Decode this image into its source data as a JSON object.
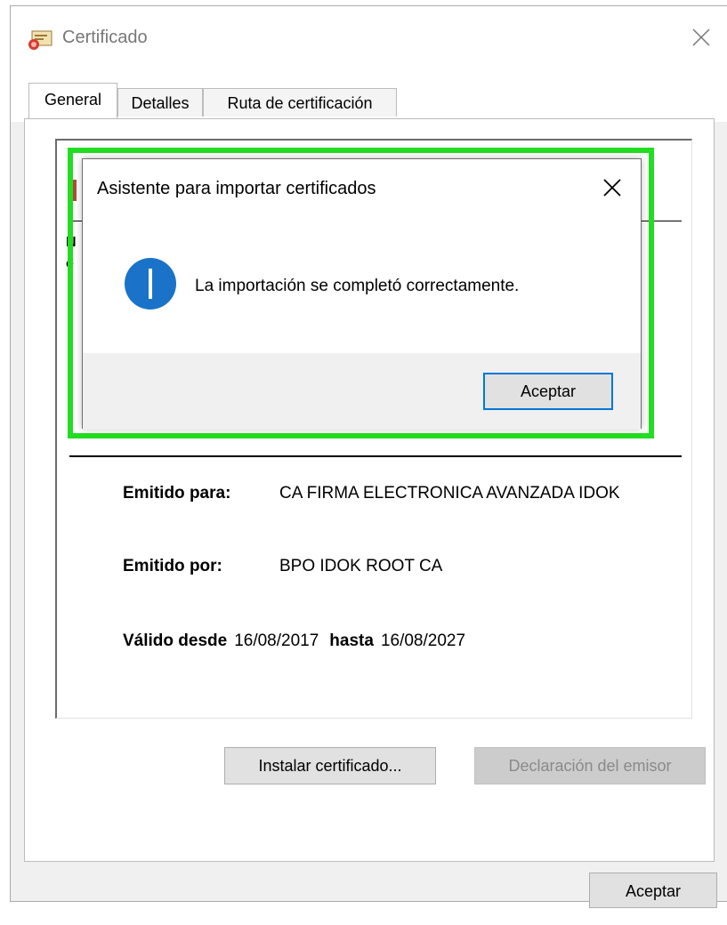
{
  "window": {
    "title": "Certificado"
  },
  "tabs": [
    {
      "label": "General",
      "active": true
    },
    {
      "label": "Detalles",
      "active": false
    },
    {
      "label": "Ruta de certificación",
      "active": false
    }
  ],
  "certificate": {
    "peek_letters": [
      "N",
      "e"
    ],
    "issued_to_label": "Emitido para:",
    "issued_to_value": "CA FIRMA ELECTRONICA AVANZADA IDOK",
    "issued_by_label": "Emitido por:",
    "issued_by_value": "BPO IDOK ROOT CA",
    "valid_from_label": "Válido desde",
    "valid_from_value": "16/08/2017",
    "valid_to_label": "hasta",
    "valid_to_value": "16/08/2027"
  },
  "buttons": {
    "install": "Instalar certificado...",
    "issuer_statement": "Declaración del emisor",
    "ok": "Aceptar"
  },
  "dialog": {
    "title": "Asistente para importar certificados",
    "message": "La importación se completó correctamente.",
    "ok": "Aceptar"
  },
  "colors": {
    "highlight": "#22dd22",
    "info_icon": "#1a73c8",
    "focus_border": "#0078d7"
  }
}
